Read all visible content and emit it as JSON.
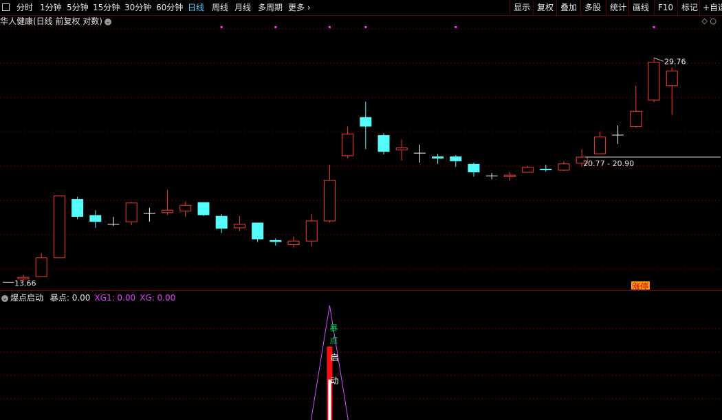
{
  "toolbar": {
    "periods": [
      "分时",
      "1分钟",
      "5分钟",
      "15分钟",
      "30分钟",
      "60分钟",
      "日线",
      "周线",
      "月线",
      "多周期",
      "更多"
    ],
    "active_period": "日线",
    "more_icon": "chevron-right-icon",
    "right_tools": [
      "显示",
      "复权",
      "叠加",
      "多股",
      "统计",
      "画线",
      "F10",
      "标记",
      "+自选"
    ]
  },
  "header": {
    "title": "华人健康(日线 前复权 对数)",
    "chevron_icon": "chevron-down-icon"
  },
  "chart_data": {
    "type": "candlestick",
    "price_scale": "log",
    "ylim": [
      13.2,
      33.0
    ],
    "candles": [
      {
        "o": 13.55,
        "h": 13.75,
        "l": 13.45,
        "c": 13.62
      },
      {
        "o": 13.66,
        "h": 14.85,
        "l": 13.66,
        "c": 14.6
      },
      {
        "o": 14.6,
        "h": 18.2,
        "l": 14.6,
        "c": 18.2
      },
      {
        "o": 18.0,
        "h": 18.15,
        "l": 16.75,
        "c": 16.9
      },
      {
        "o": 17.0,
        "h": 17.3,
        "l": 16.25,
        "c": 16.6
      },
      {
        "o": 16.45,
        "h": 16.9,
        "l": 16.35,
        "c": 16.4
      },
      {
        "o": 16.6,
        "h": 17.8,
        "l": 16.4,
        "c": 17.75
      },
      {
        "o": 17.1,
        "h": 17.45,
        "l": 16.6,
        "c": 17.1
      },
      {
        "o": 17.15,
        "h": 18.6,
        "l": 17.0,
        "c": 17.3
      },
      {
        "o": 17.25,
        "h": 17.85,
        "l": 16.9,
        "c": 17.6
      },
      {
        "o": 17.8,
        "h": 17.8,
        "l": 16.95,
        "c": 17.0
      },
      {
        "o": 16.95,
        "h": 17.05,
        "l": 15.95,
        "c": 16.2
      },
      {
        "o": 16.25,
        "h": 16.95,
        "l": 16.05,
        "c": 16.45
      },
      {
        "o": 16.55,
        "h": 16.55,
        "l": 15.45,
        "c": 15.6
      },
      {
        "o": 15.55,
        "h": 15.65,
        "l": 15.25,
        "c": 15.45
      },
      {
        "o": 15.3,
        "h": 15.75,
        "l": 15.15,
        "c": 15.5
      },
      {
        "o": 15.5,
        "h": 17.05,
        "l": 15.2,
        "c": 16.65
      },
      {
        "o": 16.65,
        "h": 20.35,
        "l": 16.55,
        "c": 19.25
      },
      {
        "o": 21.0,
        "h": 23.3,
        "l": 20.8,
        "c": 22.7
      },
      {
        "o": 24.1,
        "h": 25.45,
        "l": 21.5,
        "c": 23.3
      },
      {
        "o": 22.6,
        "h": 22.75,
        "l": 21.1,
        "c": 21.3
      },
      {
        "o": 21.45,
        "h": 22.25,
        "l": 20.65,
        "c": 21.6
      },
      {
        "o": 21.15,
        "h": 21.85,
        "l": 20.5,
        "c": 21.2
      },
      {
        "o": 20.95,
        "h": 21.15,
        "l": 20.4,
        "c": 20.8
      },
      {
        "o": 20.95,
        "h": 21.05,
        "l": 20.2,
        "c": 20.6
      },
      {
        "o": 20.4,
        "h": 20.5,
        "l": 19.5,
        "c": 19.8
      },
      {
        "o": 19.55,
        "h": 19.75,
        "l": 19.3,
        "c": 19.55
      },
      {
        "o": 19.5,
        "h": 19.8,
        "l": 19.2,
        "c": 19.6
      },
      {
        "o": 19.8,
        "h": 20.25,
        "l": 19.8,
        "c": 20.15
      },
      {
        "o": 20.05,
        "h": 20.35,
        "l": 19.85,
        "c": 19.95
      },
      {
        "o": 19.95,
        "h": 20.6,
        "l": 19.9,
        "c": 20.4
      },
      {
        "o": 20.45,
        "h": 21.5,
        "l": 20.2,
        "c": 20.9
      },
      {
        "o": 21.15,
        "h": 22.9,
        "l": 21.15,
        "c": 22.45
      },
      {
        "o": 22.6,
        "h": 23.4,
        "l": 21.9,
        "c": 22.6
      },
      {
        "o": 23.3,
        "h": 26.95,
        "l": 23.2,
        "c": 24.6
      },
      {
        "o": 25.6,
        "h": 29.76,
        "l": 25.4,
        "c": 29.3
      },
      {
        "o": 26.95,
        "h": 28.75,
        "l": 24.3,
        "c": 28.4
      }
    ],
    "labels": {
      "high": "29.76",
      "low": "13.66",
      "range": "20.77 - 20.90"
    },
    "range_line_price": 20.9,
    "tag": "涨停",
    "top_marker_indices": [
      11,
      14,
      17,
      19,
      24,
      35
    ],
    "colors": {
      "up": "#ff3b30",
      "down": "#54fcfc",
      "doji": "#ffffff",
      "grid": "#6b0000",
      "marker": "#ff33ff",
      "tag_bg": "#ff9a00",
      "tag_text": "#cc0000",
      "indicator_line": "#d050ff",
      "label_green": "#00cc55",
      "bar_red": "#ff1010"
    }
  },
  "indicator": {
    "name": "爆点启动",
    "items": [
      {
        "label": "暴点: 0.00",
        "color": "#e6e6e6"
      },
      {
        "label": "XG1: 0.00",
        "color": "#e040ff"
      },
      {
        "label": "XG: 0.00",
        "color": "#e040ff"
      }
    ],
    "signal_index": 17,
    "triangle_peak": 1.0,
    "text_1_chars": [
      "暴",
      "点"
    ],
    "text_2_chars": [
      "启",
      "动"
    ]
  }
}
